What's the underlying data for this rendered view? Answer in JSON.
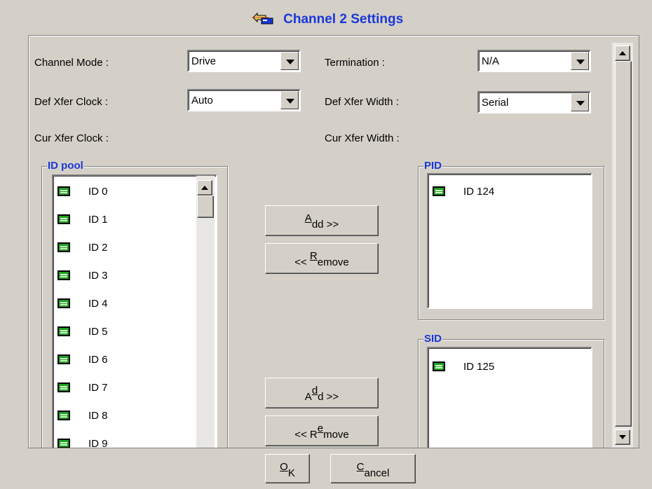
{
  "window": {
    "title": "Channel 2 Settings",
    "icon": "channel-icon"
  },
  "settings": {
    "channel_mode_label": "Channel Mode :",
    "channel_mode_value": "Drive",
    "termination_label": "Termination :",
    "termination_value": "N/A",
    "def_clock_label": "Def Xfer Clock :",
    "def_clock_value": "Auto",
    "def_width_label": "Def Xfer Width :",
    "def_width_value": "Serial",
    "cur_clock_label": "Cur Xfer Clock :",
    "cur_width_label": "Cur Xfer Width :"
  },
  "id_pool": {
    "label": "ID pool",
    "items": [
      "ID 0",
      "ID 1",
      "ID 2",
      "ID 3",
      "ID 4",
      "ID 5",
      "ID 6",
      "ID 7",
      "ID 8",
      "ID 9"
    ]
  },
  "pid": {
    "label": "PID",
    "items": [
      "ID 124"
    ]
  },
  "sid": {
    "label": "SID",
    "items": [
      "ID 125"
    ]
  },
  "buttons": {
    "add_pid_pre": "",
    "add_pid_u": "A",
    "add_pid_post": "dd >>",
    "remove_pid_pre": "<< ",
    "remove_pid_u": "R",
    "remove_pid_post": "emove",
    "add_sid_pre": "A",
    "add_sid_u": "d",
    "add_sid_post": "d >>",
    "remove_sid_pre": "<< R",
    "remove_sid_u": "e",
    "remove_sid_post": "move",
    "ok_u": "O",
    "ok_post": "K",
    "cancel_u": "C",
    "cancel_post": "ancel"
  },
  "colors": {
    "accent": "#1a37d8",
    "background": "#d4d0c8",
    "device_icon": "#1ea01e"
  }
}
